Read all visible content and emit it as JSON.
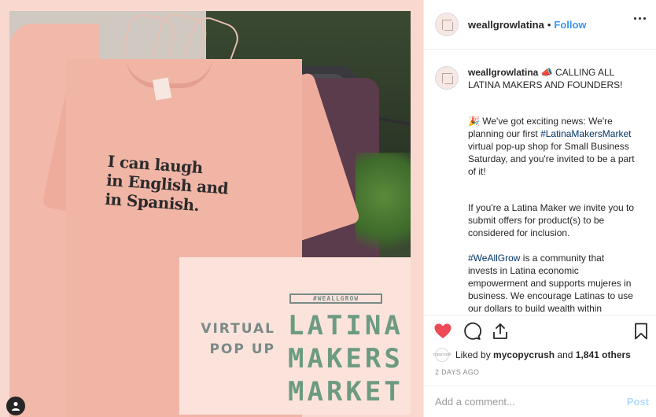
{
  "image": {
    "shirt_print_lines": [
      "I can laugh",
      "in English and",
      "in Spanish."
    ],
    "promo_tag": "#WEALLGROW",
    "promo_virtual_lines": [
      "VIRTUAL",
      "POP UP"
    ],
    "promo_main_lines": [
      "LATINA",
      "MAKERS",
      "MARKET"
    ]
  },
  "header": {
    "username": "weallgrowlatina",
    "separator": "•",
    "follow_label": "Follow",
    "more_icon": "more-options-icon"
  },
  "caption": {
    "username": "weallgrowlatina",
    "para1": "📣 CALLING ALL LATINA MAKERS AND FOUNDERS!",
    "para2_prefix": "🎉 We've got exciting news: We're planning our first ",
    "para2_hashtag": "#LatinaMakersMarket",
    "para2_suffix": " virtual pop-up shop for Small Business Saturday, and you're invited to be a part of it!",
    "para3": "If you're a Latina Maker we invite you to submit offers for product(s) to be considered for inclusion.",
    "para4_hashtag": "#WeAllGrow",
    "para4_suffix": " is a community that invests in Latina economic empowerment and supports mujeres in business. We encourage Latinas to use our dollars to build wealth within"
  },
  "actions": {
    "icons": [
      "heart-icon",
      "comment-icon",
      "share-icon",
      "bookmark-icon"
    ],
    "liked": true,
    "like_color": "#ed4956"
  },
  "likes": {
    "avatar_text": "copycrush",
    "prefix": "Liked by ",
    "user": "mycopycrush",
    "middle": " and ",
    "count": "1,841 others"
  },
  "timestamp": "2 DAYS AGO",
  "comment": {
    "placeholder": "Add a comment...",
    "post_label": "Post"
  }
}
